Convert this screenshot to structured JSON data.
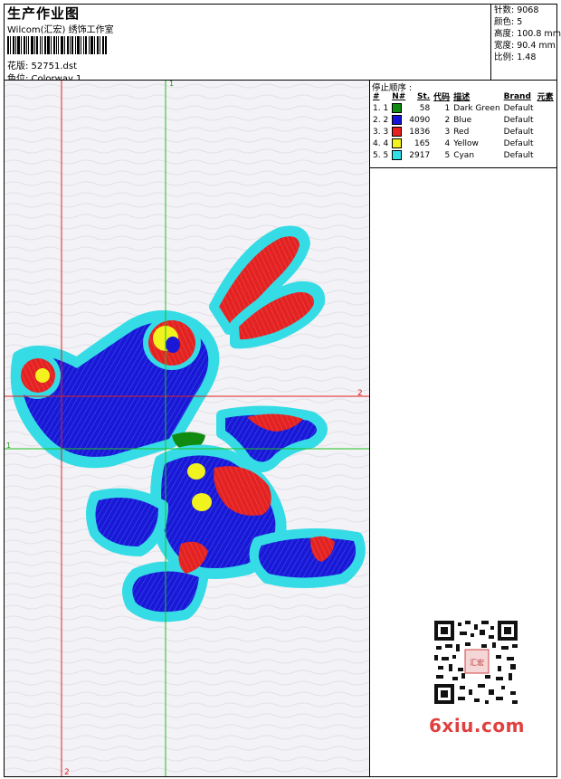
{
  "header": {
    "title": "生产作业图",
    "studio": "Wilcom(汇宏) 绣饰工作室",
    "design_label": "花版: 52751.dst",
    "colorway_label": "色位:  Colorway 1"
  },
  "stats": {
    "stitches": "针数:  9068",
    "colors": "颜色:  5",
    "height": "高度:  100.8 mm",
    "width": "宽度:  90.4 mm",
    "ratio": "比例:  1.48"
  },
  "markers": {
    "v_green_top": "1",
    "h_green_left": "1",
    "h_red_right": "2",
    "v_red_bottom": "2"
  },
  "stop_sequence": {
    "title": "停止顺序 :",
    "headers": [
      "#",
      "N#",
      "St.",
      "代码",
      "描述",
      "Brand",
      "元素"
    ],
    "rows": [
      {
        "idx": "1. 1",
        "color": "#108a10",
        "stitches": "58",
        "code": "1",
        "desc": "Dark Green",
        "brand": "Default"
      },
      {
        "idx": "2. 2",
        "color": "#1414d8",
        "stitches": "4090",
        "code": "2",
        "desc": "Blue",
        "brand": "Default"
      },
      {
        "idx": "3. 3",
        "color": "#e82020",
        "stitches": "1836",
        "code": "3",
        "desc": "Red",
        "brand": "Default"
      },
      {
        "idx": "4. 4",
        "color": "#f2f21e",
        "stitches": "165",
        "code": "4",
        "desc": "Yellow",
        "brand": "Default"
      },
      {
        "idx": "5. 5",
        "color": "#30e0e8",
        "stitches": "2917",
        "code": "5",
        "desc": "Cyan",
        "brand": "Default"
      }
    ]
  },
  "watermark": "6xiu.com",
  "qr_logo_text": "汇宏"
}
